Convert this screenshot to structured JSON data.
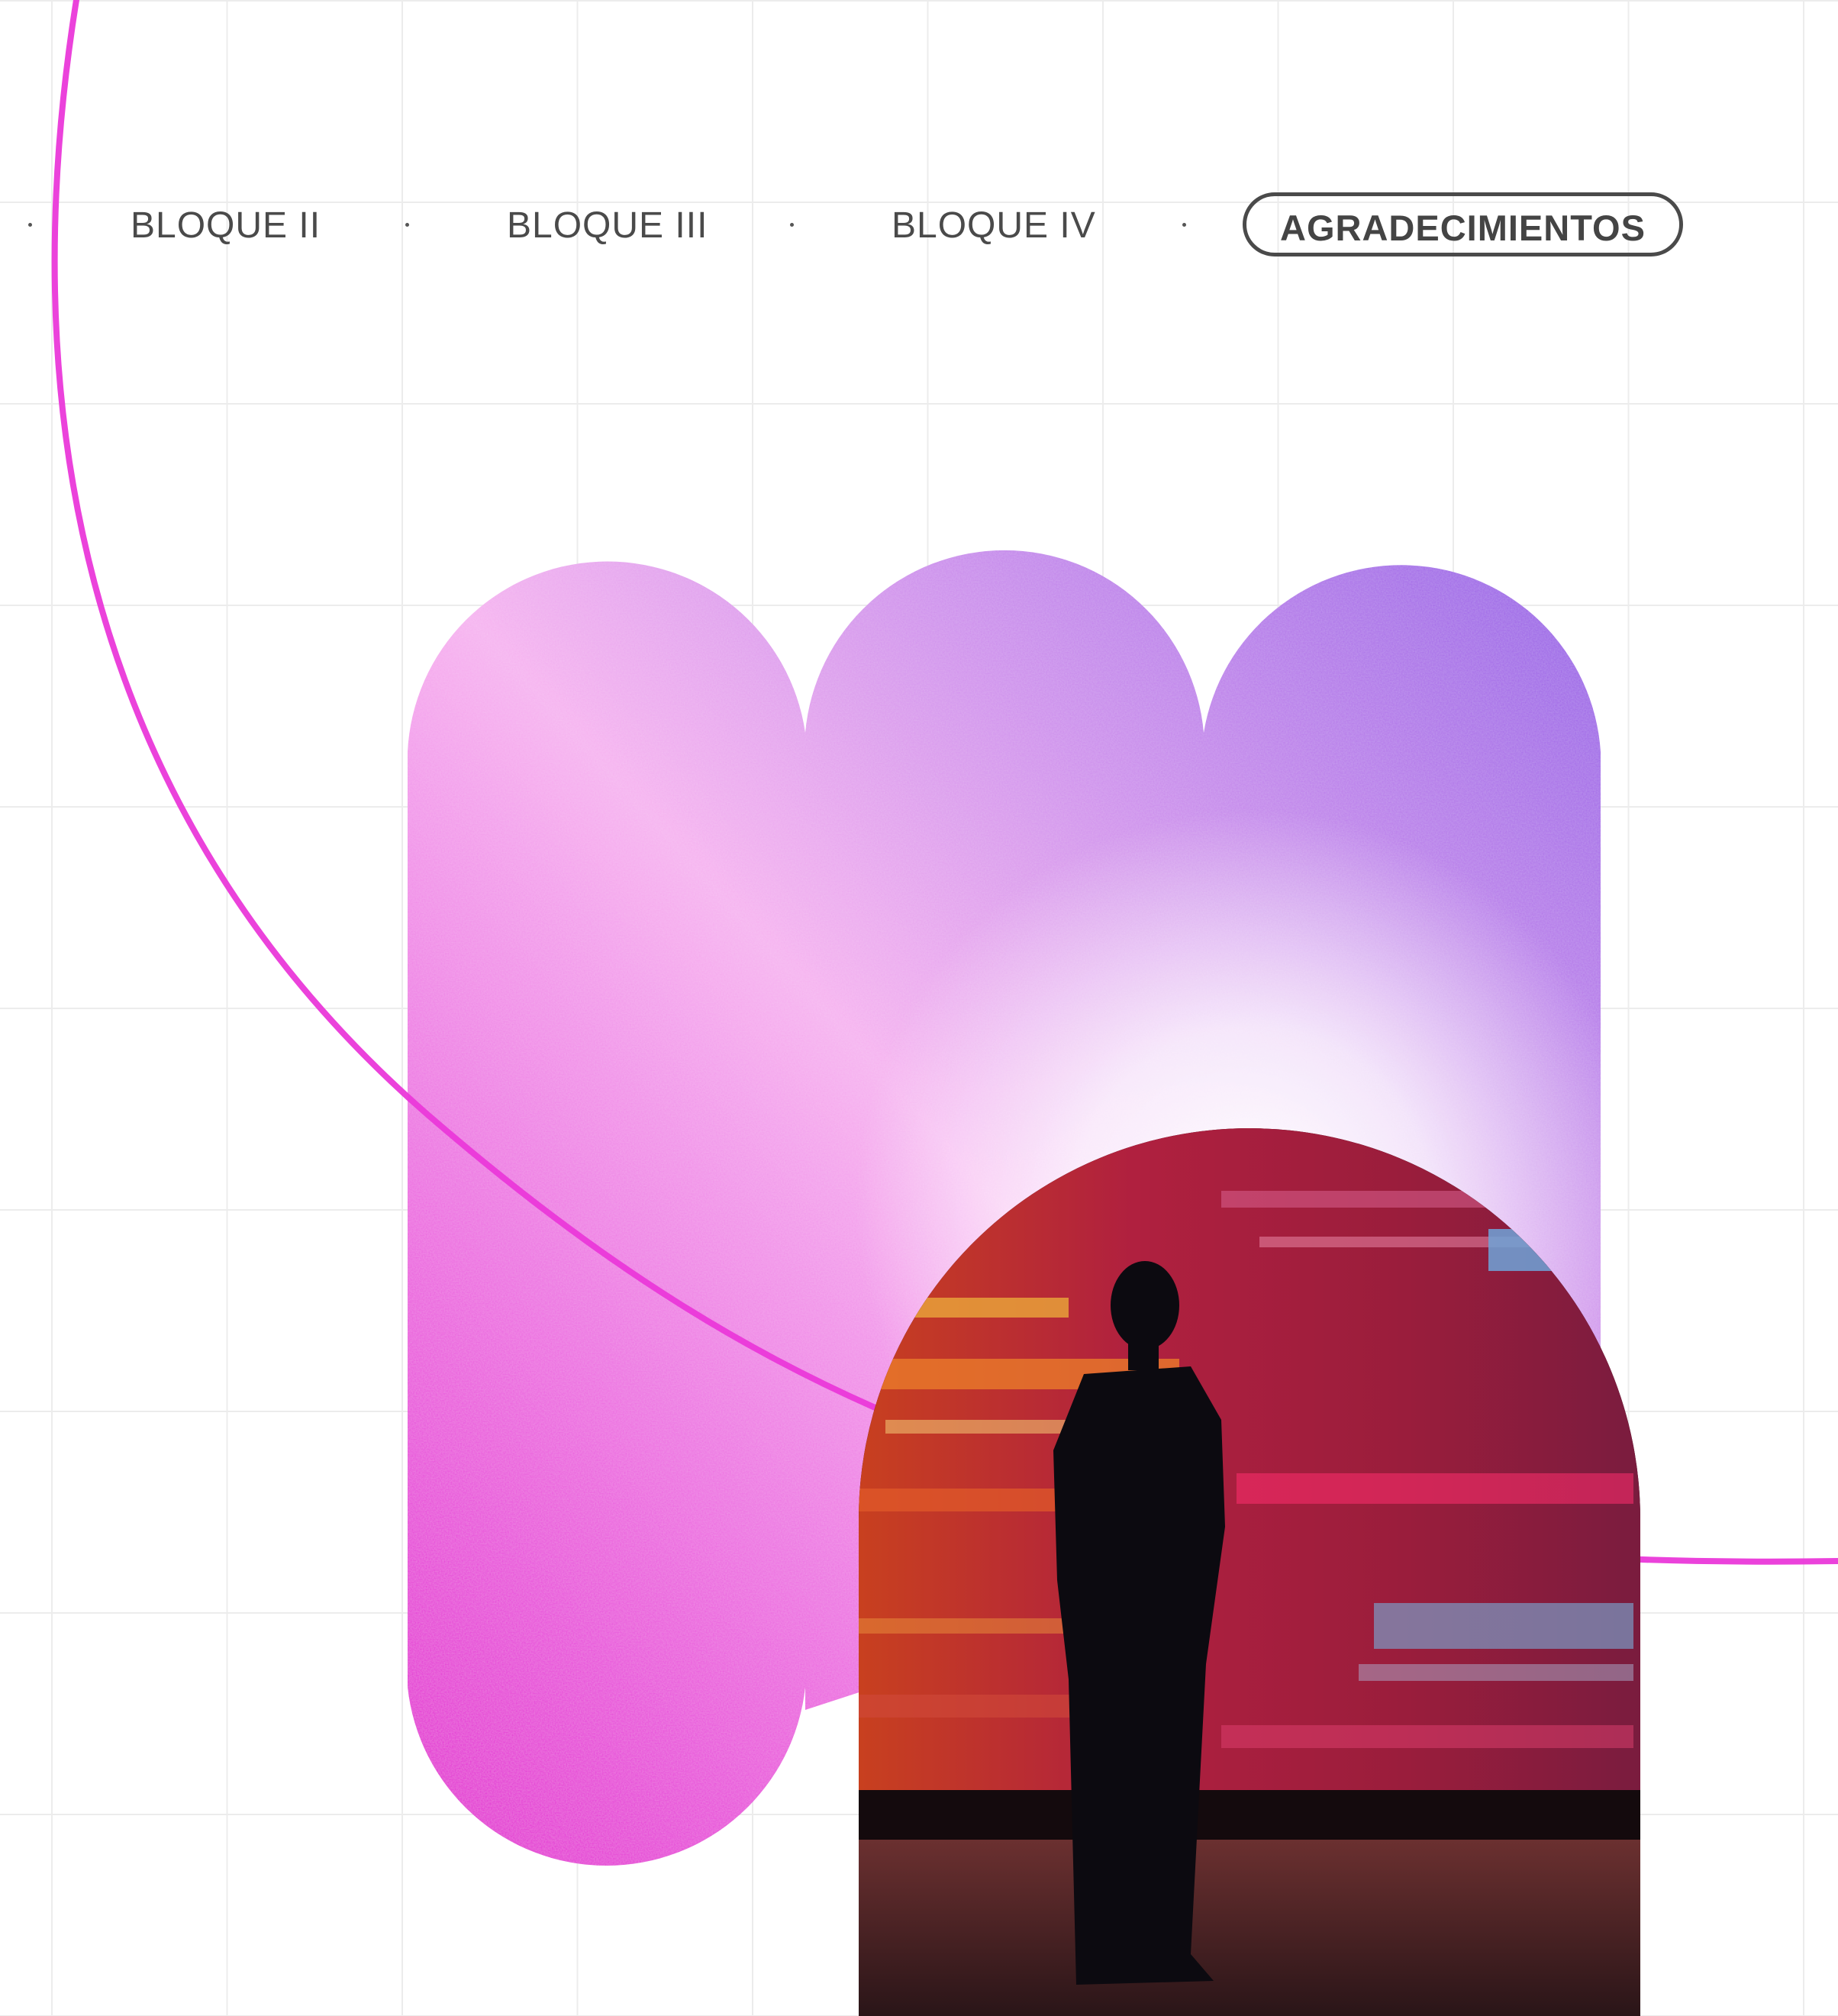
{
  "nav": {
    "items": [
      {
        "label": "BLOQUE II",
        "active": false
      },
      {
        "label": "BLOQUE III",
        "active": false
      },
      {
        "label": "BLOQUE IV",
        "active": false
      },
      {
        "label": "AGRADECIMIENTOS",
        "active": true
      }
    ]
  },
  "colors": {
    "magenta": "#e63ad6",
    "pink_light": "#fbc8f5",
    "purple": "#9b62e6",
    "nav_text": "#4a4a4a",
    "grid_line": "#ececec"
  },
  "icons": {
    "separator": "dot-separator-icon"
  }
}
